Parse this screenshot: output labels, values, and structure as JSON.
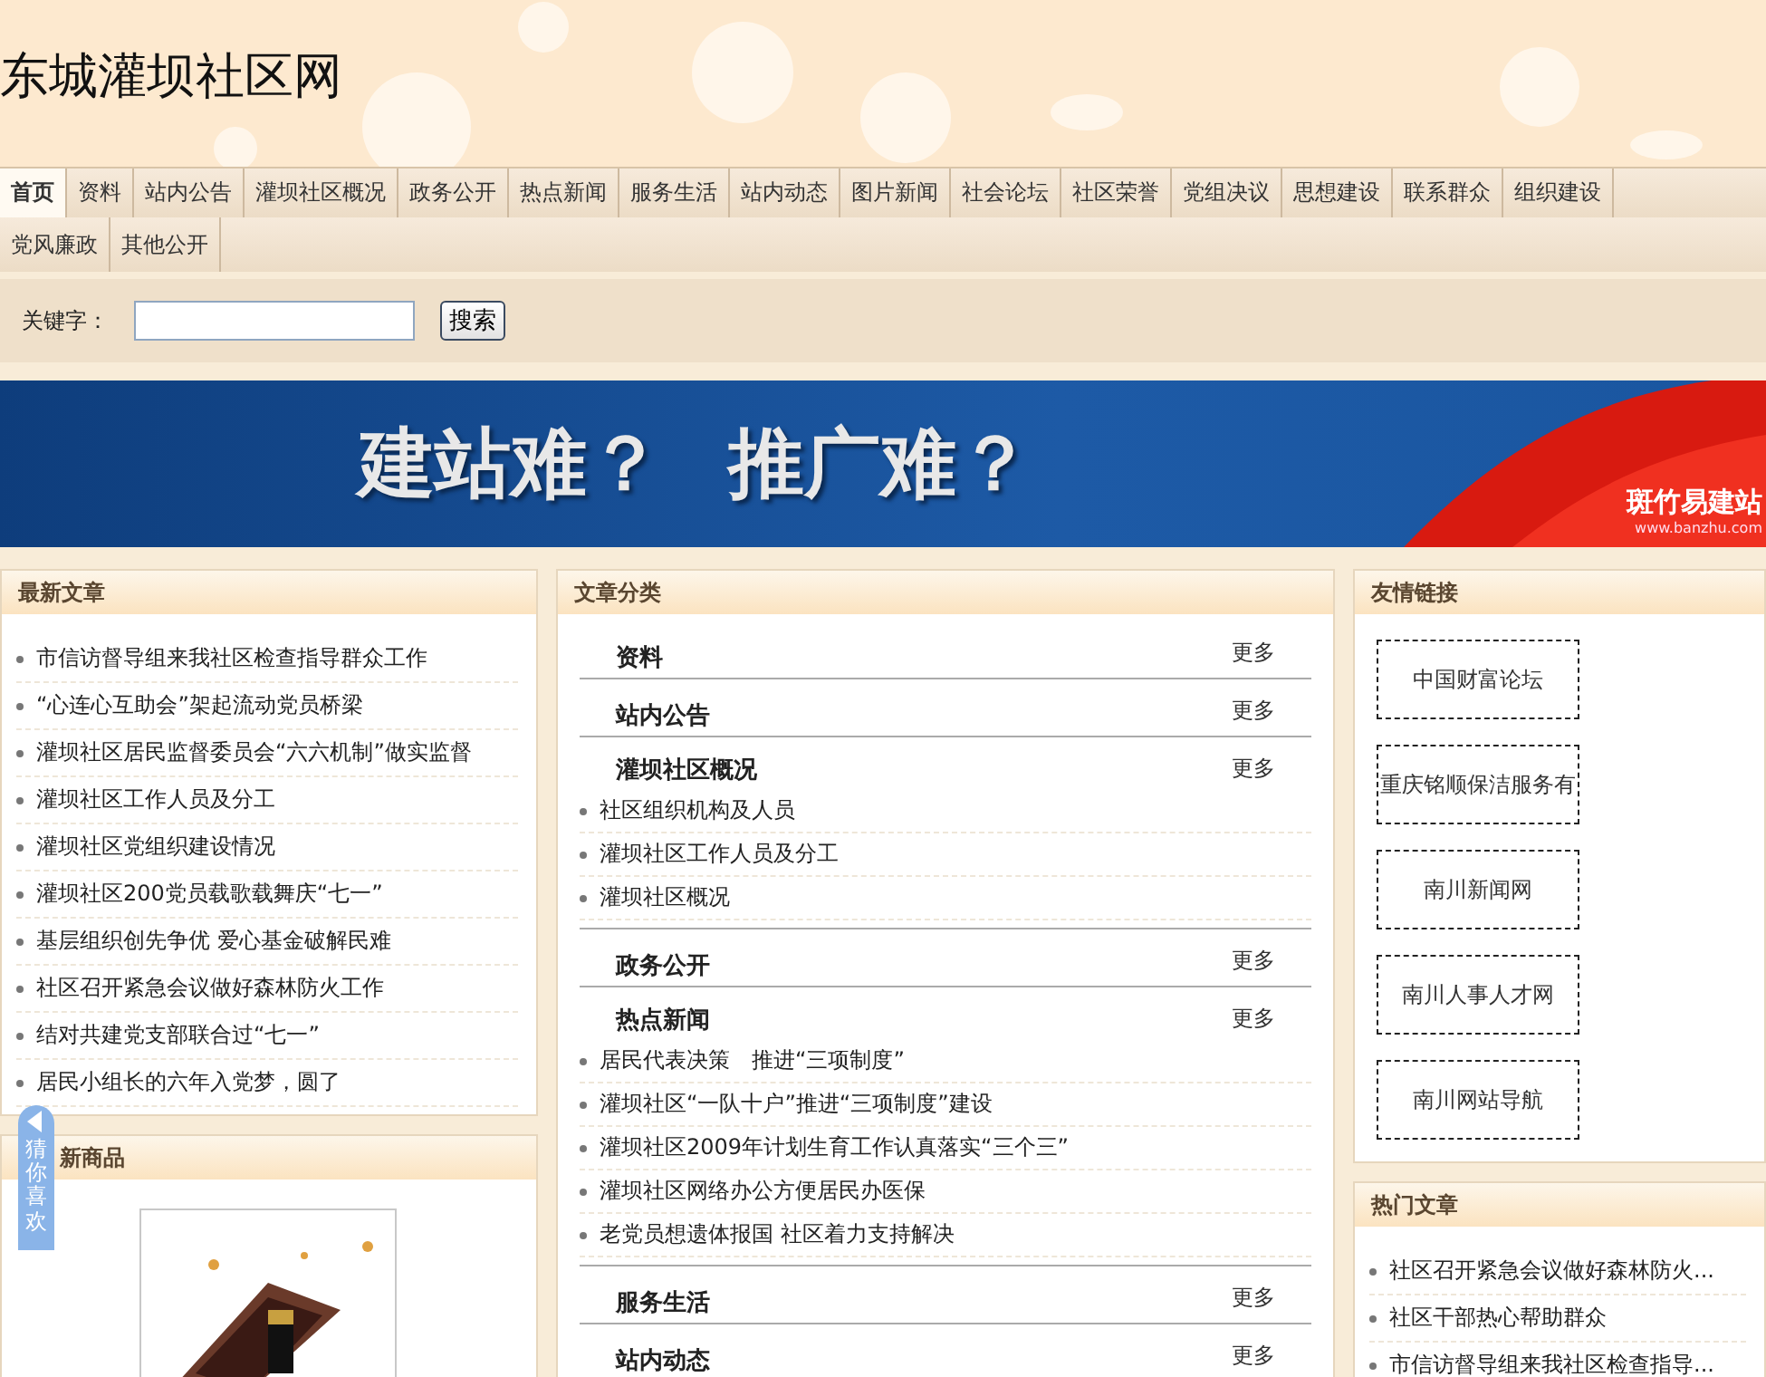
{
  "site_title": "东城灌坝社区网",
  "nav": [
    {
      "label": "首页",
      "selected": true
    },
    {
      "label": "资料",
      "selected": false
    },
    {
      "label": "站内公告",
      "selected": false
    },
    {
      "label": "灌坝社区概况",
      "selected": false
    },
    {
      "label": "政务公开",
      "selected": false
    },
    {
      "label": "热点新闻",
      "selected": false
    },
    {
      "label": "服务生活",
      "selected": false
    },
    {
      "label": "站内动态",
      "selected": false
    },
    {
      "label": "图片新闻",
      "selected": false
    },
    {
      "label": "社会论坛",
      "selected": false
    },
    {
      "label": "社区荣誉",
      "selected": false
    },
    {
      "label": "党组决议",
      "selected": false
    },
    {
      "label": "思想建设",
      "selected": false
    },
    {
      "label": "联系群众",
      "selected": false
    },
    {
      "label": "组织建设",
      "selected": false
    }
  ],
  "nav_row2": [
    {
      "label": "党风廉政",
      "selected": false
    },
    {
      "label": "其他公开",
      "selected": false
    }
  ],
  "search": {
    "label": "关键字：",
    "button": "搜索"
  },
  "banner": {
    "headline_1": "建站难？",
    "headline_2": "推广难？",
    "brand": "斑竹易建站",
    "url": "www.banzhu.com"
  },
  "latest": {
    "title": "最新文章",
    "items": [
      "市信访督导组来我社区检查指导群众工作",
      "“心连心互助会”架起流动党员桥梁",
      "灌坝社区居民监督委员会“六六机制”做实监督",
      "灌坝社区工作人员及分工",
      "灌坝社区党组织建设情况",
      "灌坝社区200党员载歌载舞庆“七一”",
      "基层组织创先争优 爱心基金破解民难",
      "社区召开紧急会议做好森林防火工作",
      "结对共建党支部联合过“七一”",
      "居民小组长的六年入党梦，圆了"
    ]
  },
  "products": {
    "title": "新商品"
  },
  "side_tab": {
    "label": "猜你喜欢"
  },
  "categories": {
    "title": "文章分类",
    "groups": [
      {
        "name": "资料",
        "more": "更多"
      },
      {
        "name": "站内公告",
        "more": "更多"
      },
      {
        "name": "灌坝社区概况",
        "more": "更多",
        "items": [
          "社区组织机构及人员",
          "灌坝社区工作人员及分工",
          "灌坝社区概况"
        ]
      },
      {
        "name": "政务公开",
        "more": "更多"
      },
      {
        "name": "热点新闻",
        "more": "更多",
        "items": [
          "居民代表决策　推进“三项制度”",
          "灌坝社区“一队十户”推进“三项制度”建设",
          "灌坝社区2009年计划生育工作认真落实“三个三”",
          "灌坝社区网络办公方便居民办医保",
          "老党员想遗体报国 社区着力支持解决"
        ]
      },
      {
        "name": "服务生活",
        "more": "更多"
      },
      {
        "name": "站内动态",
        "more": "更多"
      }
    ]
  },
  "links": {
    "title": "友情链接",
    "items": [
      "中国财富论坛",
      "重庆铭顺保洁服务有",
      "南川新闻网",
      "南川人事人才网",
      "南川网站导航"
    ]
  },
  "hot": {
    "title": "热门文章",
    "items": [
      "社区召开紧急会议做好森林防火...",
      "社区干部热心帮助群众",
      "市信访督导组来我社区检查指导..."
    ]
  }
}
